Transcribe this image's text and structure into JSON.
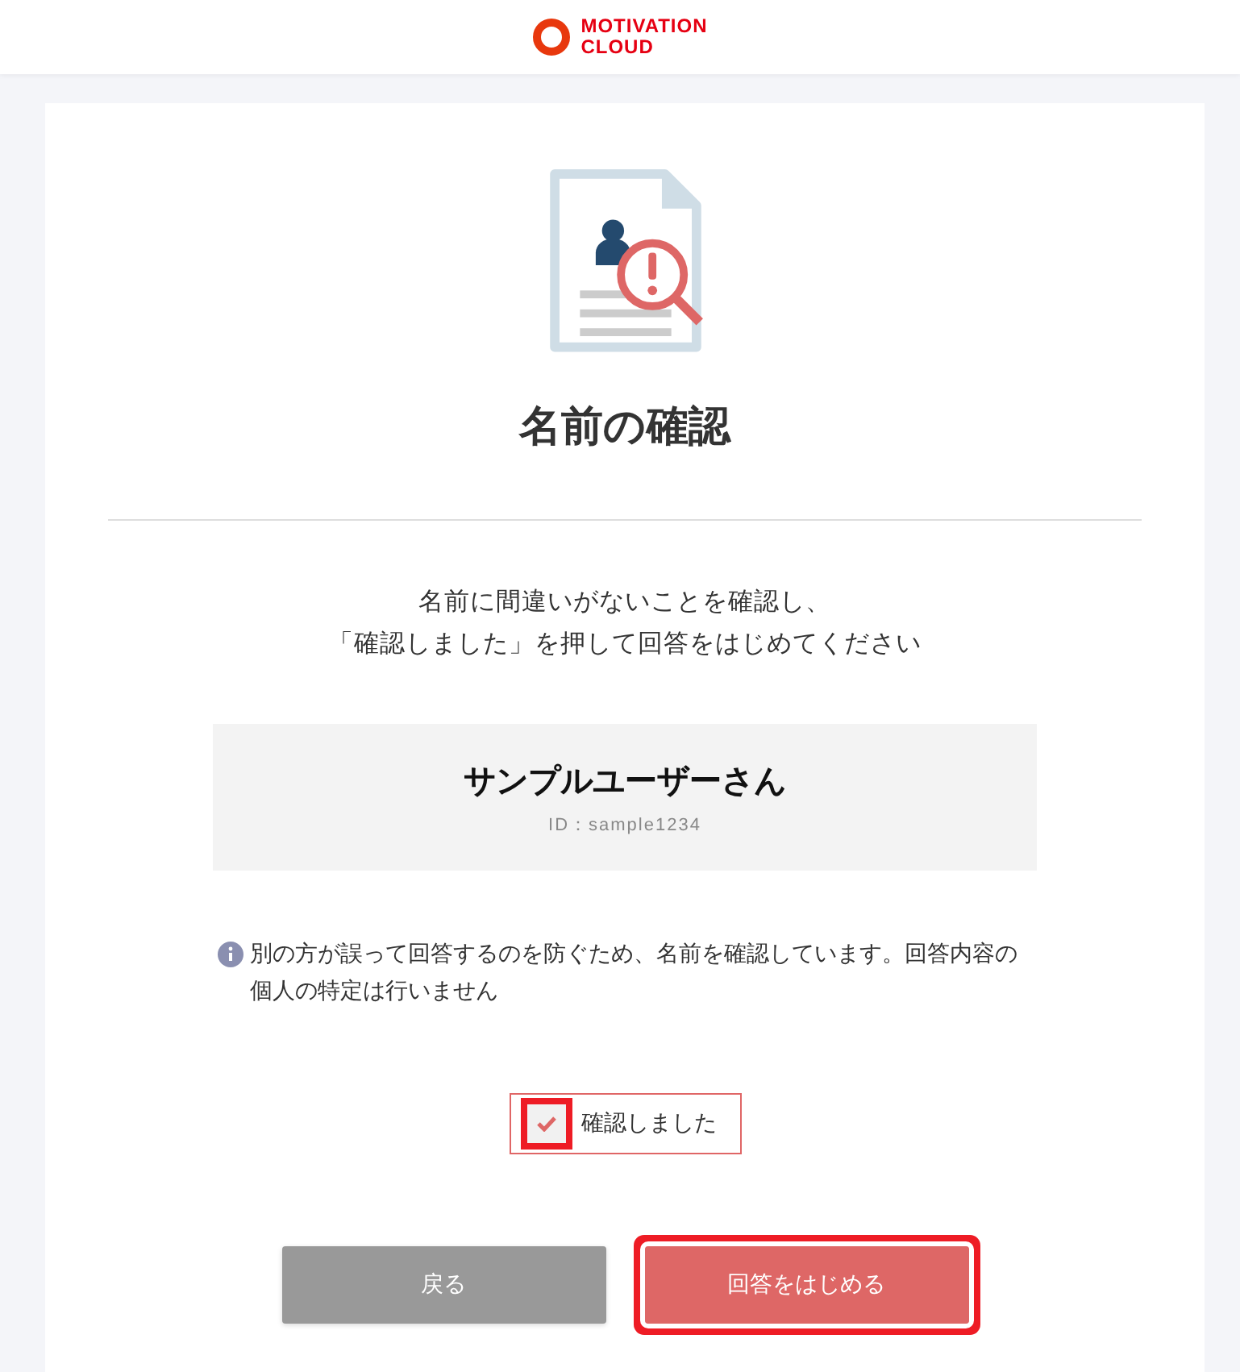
{
  "header": {
    "logo_text": [
      "MOTIVATION",
      "CLOUD"
    ]
  },
  "title": "名前の確認",
  "message": [
    "名前に間違いがないことを確認し、",
    "「確認しました」を押して回答をはじめてください"
  ],
  "user": {
    "name": "サンプルユーザーさん",
    "id": "ID：sample1234"
  },
  "note": "別の方が誤って回答するのを防ぐため、名前を確認しています。回答内容の個人の特定は行いません",
  "confirm": {
    "label": "確認しました",
    "checked": true,
    "highlighted": true
  },
  "buttons": [
    {
      "label": "戻る",
      "kind": "secondary",
      "highlighted": false
    },
    {
      "label": "回答をはじめる",
      "kind": "primary",
      "highlighted": true
    }
  ]
}
